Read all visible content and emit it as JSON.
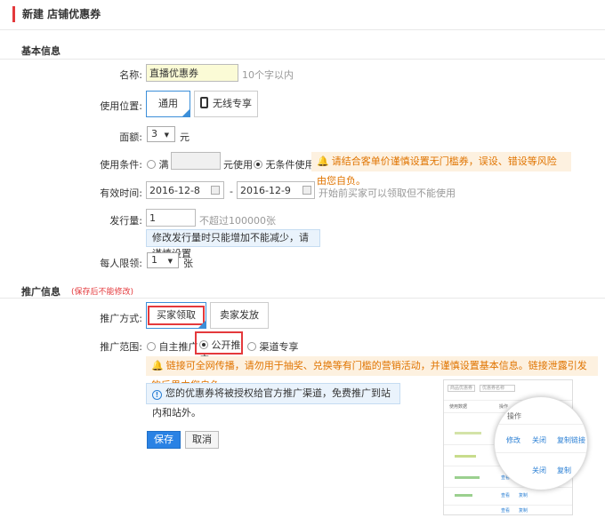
{
  "page": {
    "title": "新建 店铺优惠券"
  },
  "basic": {
    "section_title": "基本信息",
    "name": {
      "label": "名称:",
      "value": "直播优惠券",
      "hint": "10个字以内"
    },
    "location": {
      "label": "使用位置:",
      "options": [
        "通用",
        "无线专享"
      ],
      "selected": "通用"
    },
    "amount": {
      "label": "面额:",
      "value": "3",
      "unit": "元"
    },
    "condition": {
      "label": "使用条件:",
      "option_full_prefix": "满",
      "option_full_suffix": "元使用",
      "option_none": "无条件使用",
      "selected": "无条件使用",
      "warning": "请结合客单价谨慎设置无门槛券，误设、错设等风险由您自负。"
    },
    "validity": {
      "label": "有效时间:",
      "start": "2016-12-8",
      "separator": "-",
      "end": "2016-12-9",
      "hint": "开始前买家可以领取但不能使用"
    },
    "quantity": {
      "label": "发行量:",
      "value": "1",
      "hint": "不超过100000张",
      "note": "修改发行量时只能增加不能减少，请谨慎设置"
    },
    "limit": {
      "label": "每人限领:",
      "value": "1",
      "unit": "张"
    }
  },
  "promo": {
    "section_title": "推广信息",
    "section_note": "(保存后不能修改)",
    "method": {
      "label": "推广方式:",
      "options": [
        "买家领取",
        "卖家发放"
      ],
      "selected": "买家领取"
    },
    "scope": {
      "label": "推广范围:",
      "options": [
        "自主推广",
        "公开推广",
        "渠道专享"
      ],
      "selected": "公开推广",
      "warning": "链接可全网传播，请勿用于抽奖、兑换等有门槛的营销活动，并谨慎设置基本信息。链接泄露引发的后果由您自负。",
      "info": "您的优惠券将被授权给官方推广渠道，免费推广到站内和站外。"
    }
  },
  "buttons": {
    "save": "保存",
    "cancel": "取消"
  },
  "preview": {
    "select_label": "商品优惠券",
    "search_placeholder": "优惠券名称",
    "col_data": "使用数据",
    "col_ops": "操作",
    "mag_ops": "操作",
    "mag_edit": "修改",
    "mag_close": "关闭",
    "mag_copy": "复制链接",
    "mag_close2": "关闭",
    "mag_copy2": "复制",
    "row_links": [
      "修改",
      "查看",
      "查看",
      "查看"
    ],
    "row_links2": [
      "复制",
      "复制",
      "复制"
    ]
  },
  "colors": {
    "accent": "#e4393c",
    "primary": "#2a82e4",
    "warning_text": "#e07400",
    "link": "#2a7fd4"
  }
}
